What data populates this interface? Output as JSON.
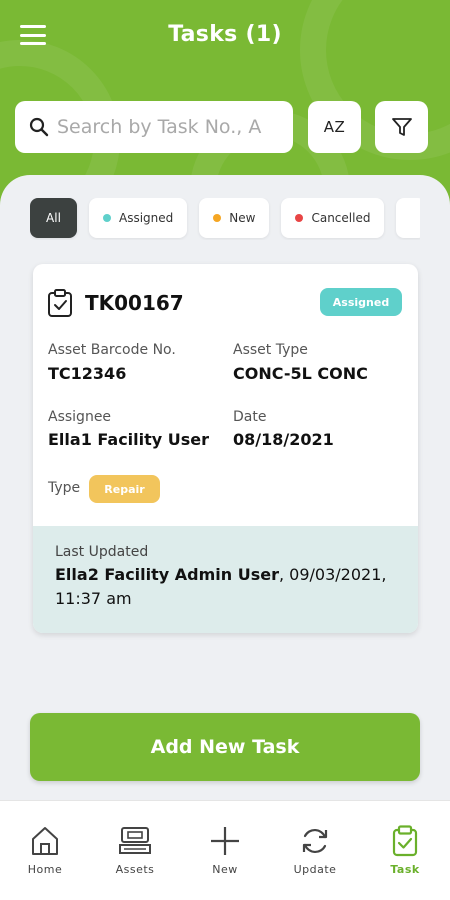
{
  "header": {
    "title": "Tasks (1)"
  },
  "search": {
    "placeholder": "Search by Task No., A"
  },
  "sort": {
    "label": "AZ"
  },
  "filters": [
    {
      "label": "All",
      "active": true
    },
    {
      "label": "Assigned",
      "color": "#5fd0cb"
    },
    {
      "label": "New",
      "color": "#f5a623"
    },
    {
      "label": "Cancelled",
      "color": "#e84545"
    }
  ],
  "task": {
    "id": "TK00167",
    "status": "Assigned",
    "asset_barcode_label": "Asset Barcode No.",
    "asset_barcode": "TC12346",
    "asset_type_label": "Asset Type",
    "asset_type": "CONC-5L CONC",
    "assignee_label": "Assignee",
    "assignee": "Ella1 Facility User",
    "date_label": "Date",
    "date": "08/18/2021",
    "type_label": "Type",
    "type": "Repair",
    "last_updated_label": "Last Updated",
    "last_updated_by": "Ella2 Facility Admin User",
    "last_updated_time": ", 09/03/2021, 11:37 am"
  },
  "add_button": {
    "label": "Add New Task"
  },
  "nav": [
    {
      "label": "Home",
      "icon": "home-icon"
    },
    {
      "label": "Assets",
      "icon": "assets-icon"
    },
    {
      "label": "New",
      "icon": "plus-icon"
    },
    {
      "label": "Update",
      "icon": "refresh-icon"
    },
    {
      "label": "Task",
      "icon": "task-clipboard-icon",
      "active": true
    }
  ],
  "colors": {
    "brand_green": "#7ab934",
    "badge_assigned": "#5fd0cb",
    "badge_repair": "#f2c55c",
    "updated_bg": "#ddeceb"
  }
}
